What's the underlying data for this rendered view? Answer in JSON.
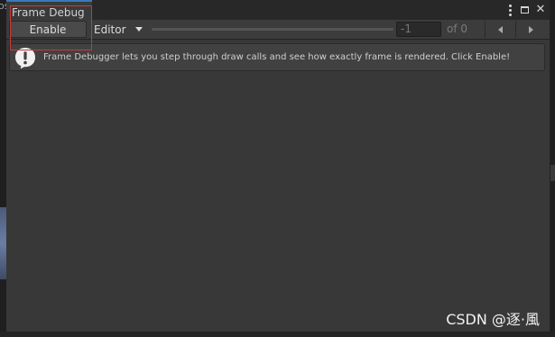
{
  "window": {
    "tab_title": "Frame Debug",
    "left_fragment": "os"
  },
  "tab_icons": [
    "kebab-menu-icon",
    "maximize-icon",
    "close-icon"
  ],
  "toolbar": {
    "enable_label": "Enable",
    "target_dropdown": {
      "selected": "Editor"
    },
    "event_index_value": "-1",
    "of_label": "of 0"
  },
  "help": {
    "icon": "warning-info-icon",
    "message": "Frame Debugger lets you step through draw calls and see how exactly frame is rendered. Click Enable!"
  },
  "watermark": "CSDN @逐·風",
  "colors": {
    "accent_tab": "#3a79bb",
    "highlight": "#c63a3a",
    "panel_bg": "#383838"
  }
}
